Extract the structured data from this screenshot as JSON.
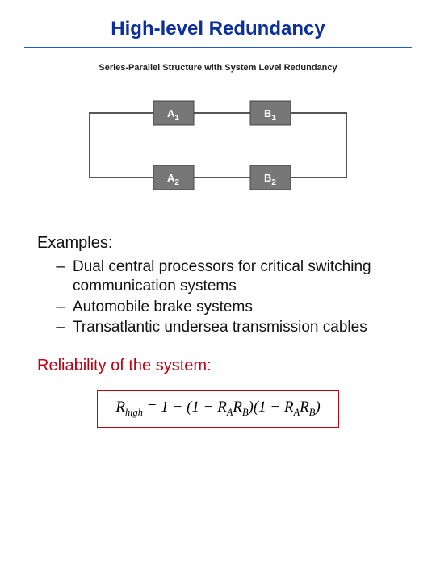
{
  "title": "High-level Redundancy",
  "diagram": {
    "caption": "Series-Parallel Structure with System Level Redundancy",
    "blocks": {
      "A1": "A",
      "A1_sub": "1",
      "B1": "B",
      "B1_sub": "1",
      "A2": "A",
      "A2_sub": "2",
      "B2": "B",
      "B2_sub": "2"
    }
  },
  "examples": {
    "heading": "Examples:",
    "items": [
      "Dual central processors for critical switching communication systems",
      "Automobile brake systems",
      "Transatlantic undersea transmission cables"
    ]
  },
  "reliability_heading": "Reliability of the system:",
  "formula": {
    "lhs_R": "R",
    "lhs_sub": "high",
    "eq": " = 1 − (1 − ",
    "RA": "R",
    "A": "A",
    "RB": "R",
    "B": "B",
    "mid": ")(1 − ",
    "end": ")"
  },
  "colors": {
    "title": "#0b2f9b",
    "rule": "#1c5cd2",
    "accent": "#c00010"
  }
}
